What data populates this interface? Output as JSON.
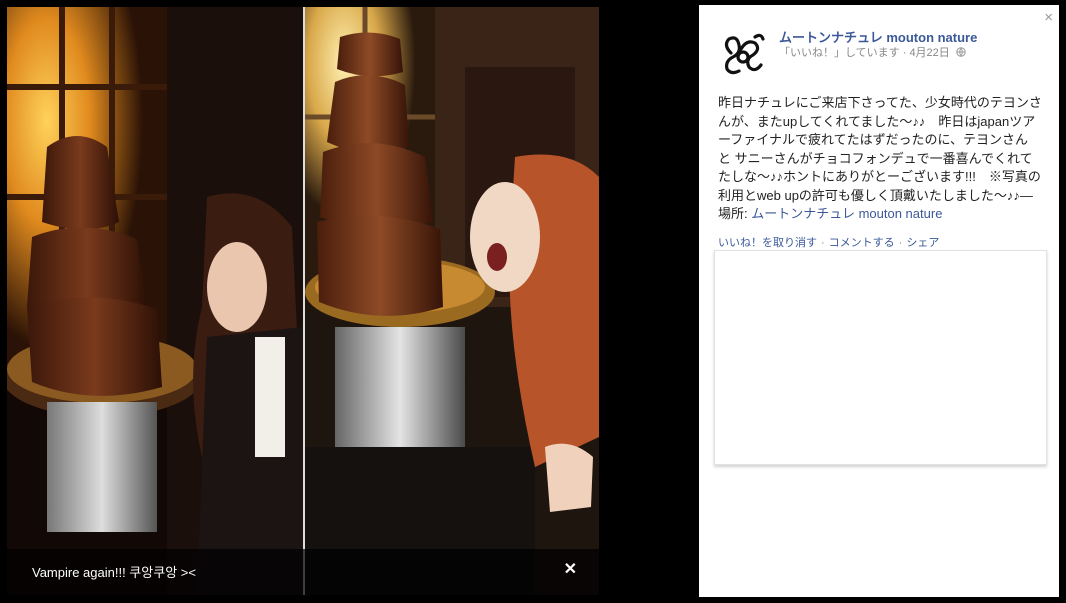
{
  "photo": {
    "caption": "Vampire again!!! 쿠앙쿠앙 ><",
    "close_icon": "close-icon",
    "colors": {
      "chocolate": "#5a2a14",
      "warm_light": "#e7a431"
    }
  },
  "sidebar": {
    "close_label": "×",
    "page_name": "ムートンナチュレ mouton nature",
    "meta": "「いいね！」しています · 4月22日",
    "post_text": "昨日ナチュレにご来店下さってた、少女時代のテヨンさんが、またupしてくれてました〜♪♪　昨日はjapanツアーファイナルで疲れてたはずだったのに、テヨンさん と サニーさんがチョコフォンデュで一番喜んでくれてたしな〜♪♪ホントにありがとーございます!!!　※写真の利用とweb upの許可も優しく頂戴いたしました〜♪♪",
    "place_prefix": "— 場所: ",
    "place_name": "ムートンナチュレ mouton nature",
    "actions": {
      "unlike": "いいね！を取り消す",
      "comment": "コメントする",
      "share": "シェア"
    },
    "accent_color": "#3b5998"
  }
}
